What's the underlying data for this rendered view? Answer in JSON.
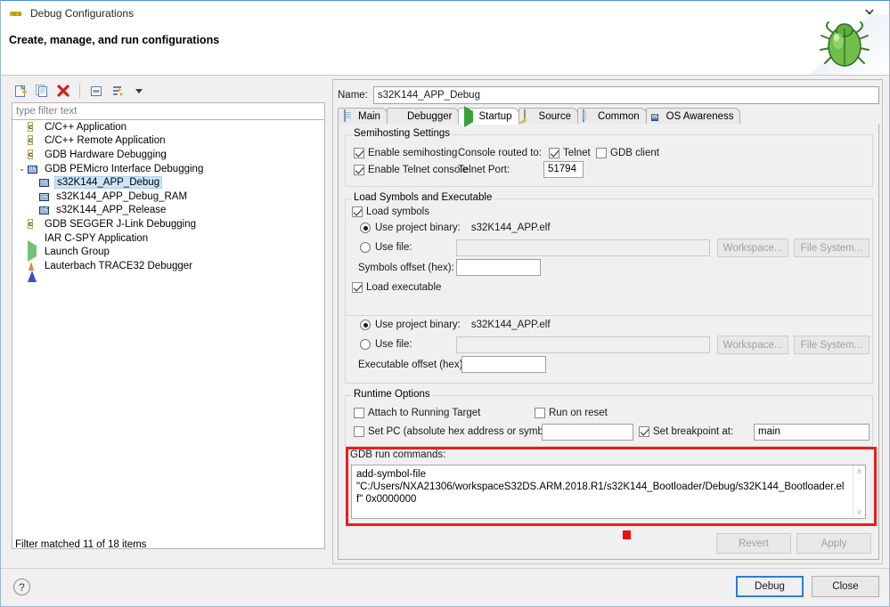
{
  "window": {
    "title": "Debug Configurations",
    "header_title": "Create, manage, and run configurations",
    "close_label": "✕",
    "bug_icon_name": "bug-icon"
  },
  "left_panel": {
    "toolbar": [
      {
        "name": "new-configuration-icon",
        "glyph": "new"
      },
      {
        "name": "duplicate-configuration-icon",
        "glyph": "copy"
      },
      {
        "name": "delete-configuration-icon",
        "glyph": "delete"
      },
      {
        "name": "collapse-all-icon",
        "glyph": "collapse"
      },
      {
        "name": "filter-icon",
        "glyph": "filter"
      },
      {
        "name": "view-menu-chevron-icon",
        "glyph": "chevron"
      }
    ],
    "filter_placeholder": "type filter text",
    "filter_value": "",
    "tree": [
      {
        "label": "C/C++ Application",
        "icon": "c",
        "indent": 0,
        "twisty": "",
        "selected": false
      },
      {
        "label": "C/C++ Remote Application",
        "icon": "c",
        "indent": 0,
        "twisty": "",
        "selected": false
      },
      {
        "label": "GDB Hardware Debugging",
        "icon": "c",
        "indent": 0,
        "twisty": "",
        "selected": false
      },
      {
        "label": "GDB PEMicro Interface Debugging",
        "icon": "pe",
        "indent": 0,
        "twisty": "expanded",
        "selected": false
      },
      {
        "label": "s32K144_APP_Debug",
        "icon": "pe",
        "indent": 1,
        "twisty": "",
        "selected": true
      },
      {
        "label": "s32K144_APP_Debug_RAM",
        "icon": "pe",
        "indent": 1,
        "twisty": "",
        "selected": false
      },
      {
        "label": "s32K144_APP_Release",
        "icon": "pe",
        "indent": 1,
        "twisty": "",
        "selected": false
      },
      {
        "label": "GDB SEGGER J-Link Debugging",
        "icon": "c",
        "indent": 0,
        "twisty": "",
        "selected": false
      },
      {
        "label": "IAR C-SPY Application",
        "icon": "smiley",
        "indent": 0,
        "twisty": "",
        "selected": false
      },
      {
        "label": "Launch Group",
        "icon": "play",
        "indent": 0,
        "twisty": "",
        "selected": false
      },
      {
        "label": "Lauterbach TRACE32 Debugger",
        "icon": "tri",
        "indent": 0,
        "twisty": "",
        "selected": false
      }
    ],
    "filter_status": "Filter matched 11 of 18 items"
  },
  "right_panel": {
    "name_label": "Name:",
    "name_value": "s32K144_APP_Debug",
    "tabs": [
      {
        "label": "Main",
        "icon": "doc",
        "active": false
      },
      {
        "label": "Debugger",
        "icon": "gear",
        "active": false
      },
      {
        "label": "Startup",
        "icon": "startup",
        "active": true
      },
      {
        "label": "Source",
        "icon": "source",
        "active": false
      },
      {
        "label": "Common",
        "icon": "common",
        "active": false
      },
      {
        "label": "OS Awareness",
        "icon": "os",
        "active": false
      }
    ],
    "semihosting": {
      "legend": "Semihosting Settings",
      "enable_semihosting": {
        "label": "Enable semihosting",
        "checked": true
      },
      "console_routed_label": "Console routed to:",
      "telnet": {
        "label": "Telnet",
        "checked": true
      },
      "gdb_client": {
        "label": "GDB client",
        "checked": false
      },
      "enable_telnet_console": {
        "label": "Enable Telnet console",
        "checked": true
      },
      "telnet_port_label": "Telnet Port:",
      "telnet_port_value": "51794"
    },
    "load_symbols": {
      "legend": "Load Symbols and Executable",
      "load_symbols": {
        "label": "Load symbols",
        "checked": true
      },
      "sym_use_project_binary": {
        "label": "Use project binary:",
        "selected": true,
        "value": "s32K144_APP.elf"
      },
      "sym_use_file": {
        "label": "Use file:",
        "selected": false,
        "value": ""
      },
      "sym_workspace_button": "Workspace...",
      "sym_filesystem_button": "File System...",
      "symbols_offset_label": "Symbols offset (hex):",
      "symbols_offset_value": "",
      "load_executable": {
        "label": "Load executable",
        "checked": true
      },
      "exe_use_project_binary": {
        "label": "Use project binary:",
        "selected": true,
        "value": "s32K144_APP.elf"
      },
      "exe_use_file": {
        "label": "Use file:",
        "selected": false,
        "value": ""
      },
      "exe_workspace_button": "Workspace...",
      "exe_filesystem_button": "File System...",
      "executable_offset_label": "Executable offset (hex):",
      "executable_offset_value": ""
    },
    "runtime_options": {
      "legend": "Runtime Options",
      "attach_to_running_target": {
        "label": "Attach to Running Target",
        "checked": false
      },
      "run_on_reset": {
        "label": "Run on reset",
        "checked": false
      },
      "set_pc": {
        "label": "Set PC (absolute hex address or symbol):",
        "checked": false,
        "value": ""
      },
      "set_breakpoint_at": {
        "label": "Set breakpoint at:",
        "checked": true,
        "value": "main"
      }
    },
    "gdb_run_commands": {
      "legend": "GDB run commands:",
      "value": "add-symbol-file\n\"C:/Users/NXA21306/workspaceS32DS.ARM.2018.R1/s32K144_Bootloader/Debug/s32K144_Bootloader.elf\" 0x0000000",
      "scroll_up_glyph": "∧",
      "scroll_down_glyph": "∨"
    },
    "revert_button": {
      "label": "Revert",
      "enabled": false
    },
    "apply_button": {
      "label": "Apply",
      "enabled": false
    }
  },
  "footer": {
    "help_glyph": "?",
    "debug_button": "Debug",
    "close_button": "Close"
  },
  "annotations": {
    "highlight_color": "#ef1b1b",
    "marker_color": "#f20d0d"
  }
}
